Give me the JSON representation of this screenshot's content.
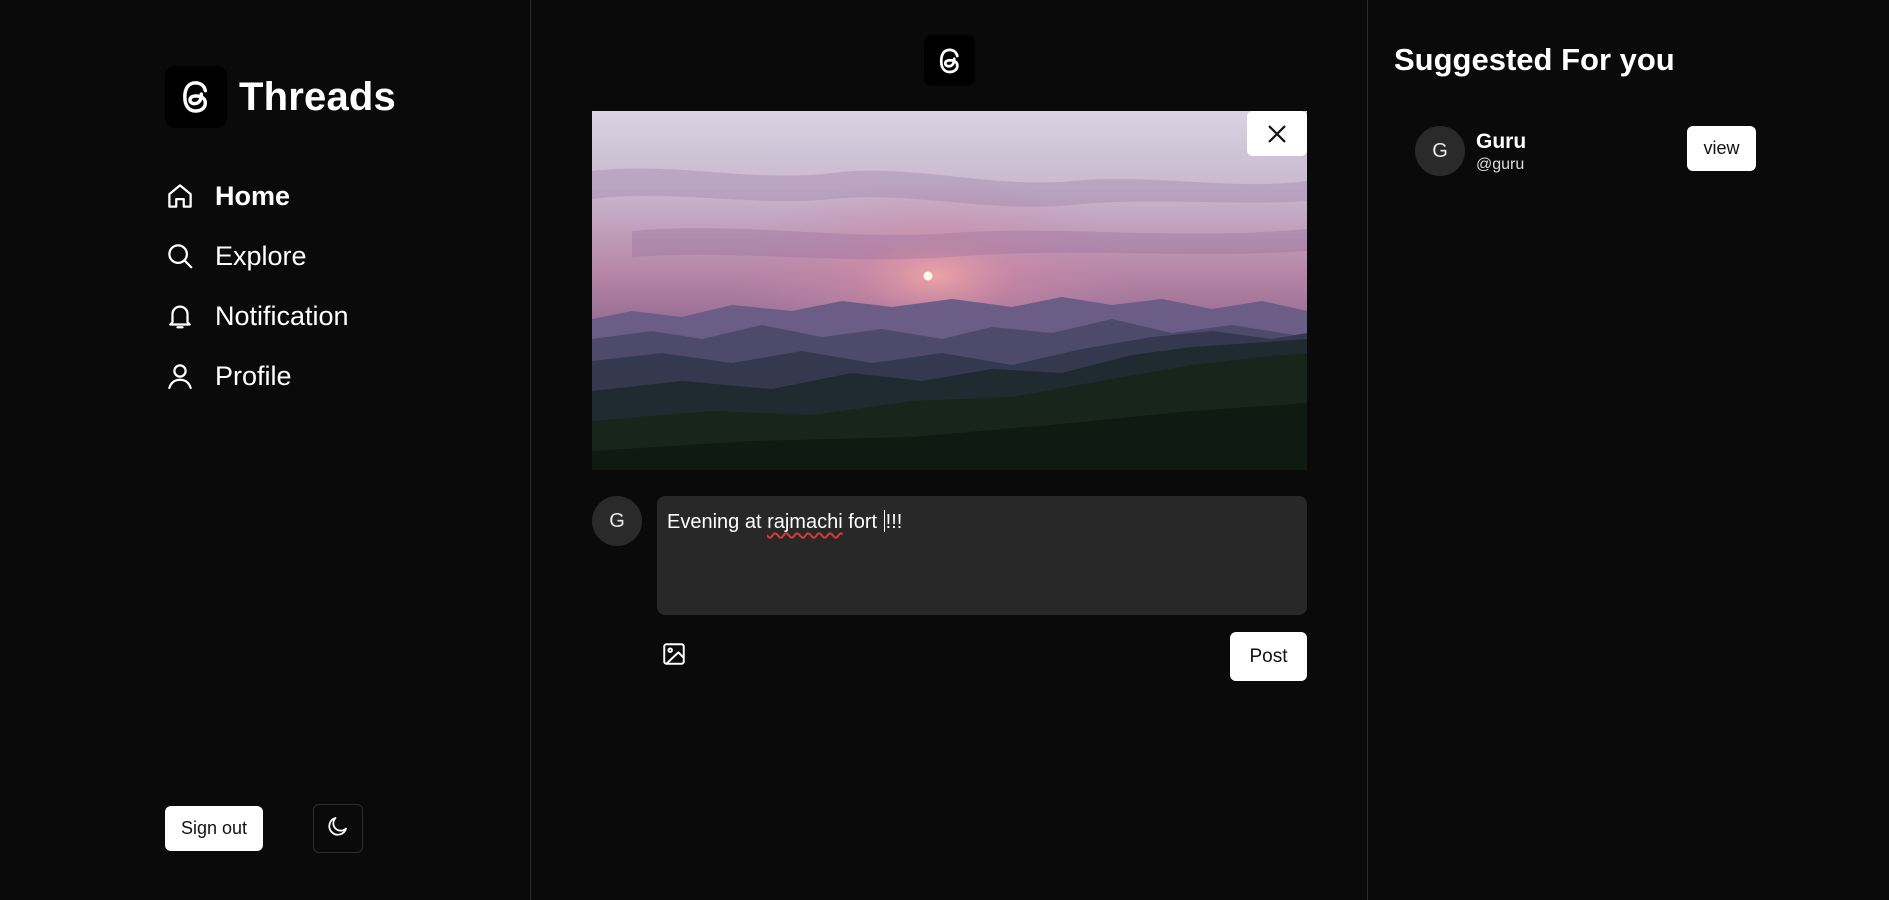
{
  "app": {
    "name": "Threads"
  },
  "nav": {
    "items": [
      {
        "label": "Home",
        "icon": "home-icon",
        "active": true
      },
      {
        "label": "Explore",
        "icon": "search-icon",
        "active": false
      },
      {
        "label": "Notification",
        "icon": "bell-icon",
        "active": false
      },
      {
        "label": "Profile",
        "icon": "user-icon",
        "active": false
      }
    ]
  },
  "footer": {
    "signout_label": "Sign out",
    "theme_icon": "moon-icon"
  },
  "composer": {
    "avatar_initial": "G",
    "text_before": "Evening at ",
    "text_misspelled": "rajmachi",
    "text_after_a": " fort ",
    "text_after_b": "!!!",
    "image_icon": "image-icon",
    "post_label": "Post",
    "preview_image": "sunset over mountain ridges"
  },
  "suggestions": {
    "title": "Suggested For you",
    "users": [
      {
        "initial": "G",
        "name": "Guru",
        "handle": "@guru",
        "action_label": "view"
      }
    ]
  },
  "colors": {
    "background": "#0a0a0a",
    "input_bg": "#282828",
    "divider": "#2c2c2c",
    "button_bg": "#ffffff"
  }
}
